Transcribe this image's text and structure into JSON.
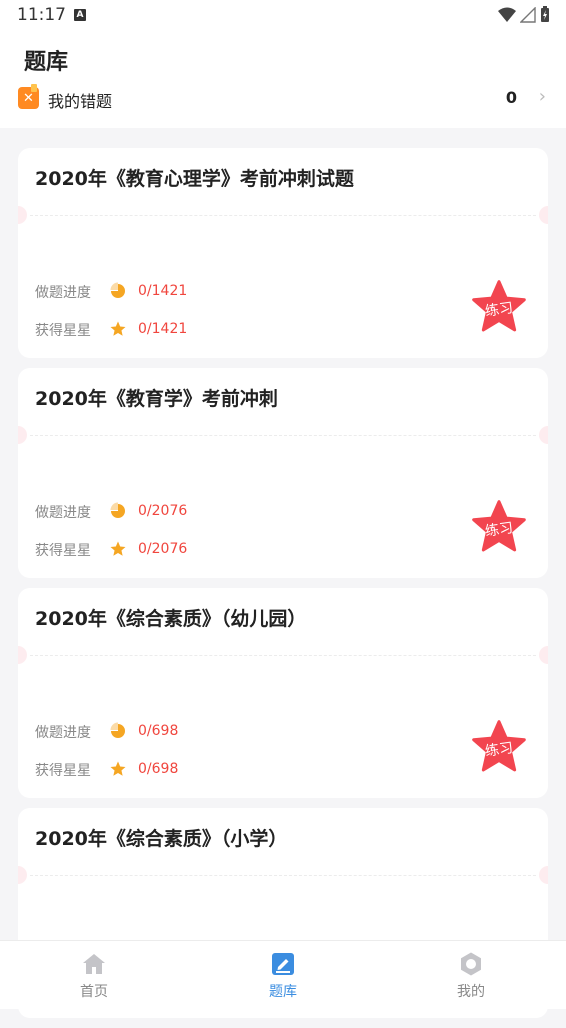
{
  "status_bar": {
    "time": "11:17",
    "badge": "A"
  },
  "header": {
    "title": "题库",
    "wrong_questions": {
      "label": "我的错题",
      "count": "0"
    }
  },
  "cards": [
    {
      "title": "2020年《教育心理学》考前冲刺试题",
      "progress_label": "做题进度",
      "progress_value": "0/1421",
      "stars_label": "获得星星",
      "stars_value": "0/1421",
      "practice_label": "练习"
    },
    {
      "title": "2020年《教育学》考前冲刺",
      "progress_label": "做题进度",
      "progress_value": "0/2076",
      "stars_label": "获得星星",
      "stars_value": "0/2076",
      "practice_label": "练习"
    },
    {
      "title": "2020年《综合素质》（幼儿园）",
      "progress_label": "做题进度",
      "progress_value": "0/698",
      "stars_label": "获得星星",
      "stars_value": "0/698",
      "practice_label": "练习"
    },
    {
      "title": "2020年《综合素质》（小学）"
    }
  ],
  "tabbar": {
    "tabs": [
      {
        "label": "首页",
        "icon": "home-icon",
        "active": false
      },
      {
        "label": "题库",
        "icon": "question-bank-icon",
        "active": true
      },
      {
        "label": "我的",
        "icon": "profile-icon",
        "active": false
      }
    ]
  },
  "colors": {
    "accent_red": "#f0463e",
    "star_orange": "#f5a623",
    "tab_active": "#3b8de0",
    "wrong_icon": "#ff8a22"
  }
}
